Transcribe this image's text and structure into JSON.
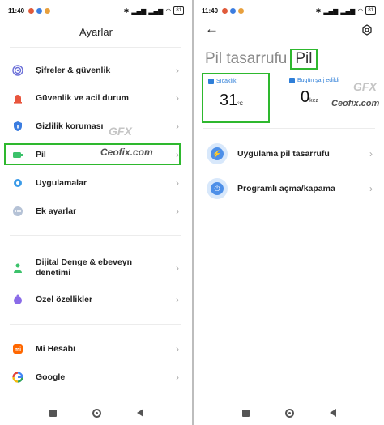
{
  "left": {
    "status": {
      "time": "11:40",
      "battery": "81"
    },
    "title": "Ayarlar",
    "items": [
      {
        "label": "Şifreler & güvenlik",
        "icon": "fingerprint-icon",
        "color": "#6b6fd8"
      },
      {
        "label": "Güvenlik ve acil durum",
        "icon": "alarm-icon",
        "color": "#e8553d"
      },
      {
        "label": "Gizlilik koruması",
        "icon": "privacy-icon",
        "color": "#3b7de0"
      },
      {
        "label": "Pil",
        "icon": "battery-icon",
        "color": "#3cc26b"
      },
      {
        "label": "Uygulamalar",
        "icon": "gear-icon",
        "color": "#3b9be8"
      },
      {
        "label": "Ek ayarlar",
        "icon": "more-icon",
        "color": "#8a9bb5"
      },
      {
        "label": "Dijital Denge & ebeveyn denetimi",
        "icon": "person-icon",
        "color": "#3cc26b"
      },
      {
        "label": "Özel özellikler",
        "icon": "accessibility-icon",
        "color": "#8a6be8"
      },
      {
        "label": "Mi Hesabı",
        "icon": "mi-icon",
        "color": "#ff6700"
      },
      {
        "label": "Google",
        "icon": "google-icon",
        "color": "#4285f4"
      }
    ],
    "watermark": "Ceofix.com",
    "watermark_logo": "GFX"
  },
  "right": {
    "status": {
      "time": "11:40",
      "battery": "81"
    },
    "title_prefix": "Pil tasarrufu",
    "title_highlight": "Pil",
    "temperature": {
      "label": "Sıcaklık",
      "value": "31",
      "unit": "°C"
    },
    "charge": {
      "label": "Bugün şarj edildi",
      "value": "0",
      "unit": "kez"
    },
    "items": [
      {
        "label": "Uygulama pil tasarrufu",
        "icon": "battery-saver-icon"
      },
      {
        "label": "Programlı açma/kapama",
        "icon": "power-icon"
      }
    ],
    "watermark": "Ceofix.com",
    "watermark_logo": "GFX"
  }
}
